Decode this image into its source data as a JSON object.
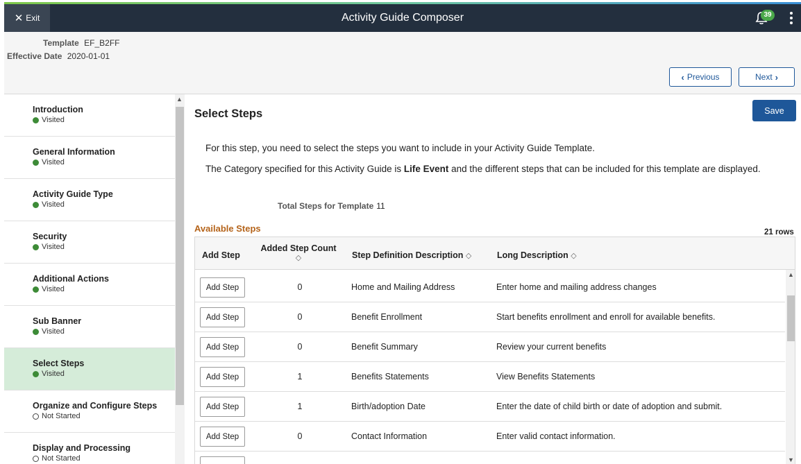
{
  "header": {
    "exit_label": "Exit",
    "title": "Activity Guide Composer",
    "notification_count": "39"
  },
  "info": {
    "template_label": "Template",
    "template_value": "EF_B2FF",
    "effective_date_label": "Effective Date",
    "effective_date_value": "2020-01-01"
  },
  "nav_buttons": {
    "previous": "Previous",
    "next": "Next"
  },
  "sidebar": {
    "items": [
      {
        "label": "Introduction",
        "status": "Visited"
      },
      {
        "label": "General Information",
        "status": "Visited"
      },
      {
        "label": "Activity Guide Type",
        "status": "Visited"
      },
      {
        "label": "Security",
        "status": "Visited"
      },
      {
        "label": "Additional Actions",
        "status": "Visited"
      },
      {
        "label": "Sub Banner",
        "status": "Visited"
      },
      {
        "label": "Select Steps",
        "status": "Visited"
      },
      {
        "label": "Organize and Configure Steps",
        "status": "Not Started"
      },
      {
        "label": "Display and Processing",
        "status": "Not Started"
      }
    ]
  },
  "main": {
    "title": "Select Steps",
    "save_label": "Save",
    "intro_text": "For this step, you need to select the steps you want to include in your Activity Guide Template.",
    "category_text_before": "The Category specified for this Activity Guide is ",
    "category_value": "Life Event",
    "category_text_after": " and the different steps that can be included for this template are displayed.",
    "total_label": "Total Steps for Template",
    "total_value": "11",
    "section_title": "Available Steps",
    "row_count": "21 rows"
  },
  "table": {
    "columns": [
      "Add Step",
      "Added Step Count",
      "Step Definition Description",
      "Long Description"
    ],
    "add_button_label": "Add Step",
    "rows": [
      {
        "count": "0",
        "definition": "Home and Mailing Address",
        "long": "Enter home and mailing address changes"
      },
      {
        "count": "0",
        "definition": "Benefit Enrollment",
        "long": "Start benefits enrollment and enroll for available benefits."
      },
      {
        "count": "0",
        "definition": "Benefit Summary",
        "long": "Review your current benefits"
      },
      {
        "count": "1",
        "definition": "Benefits Statements",
        "long": "View Benefits Statements"
      },
      {
        "count": "1",
        "definition": "Birth/adoption Date",
        "long": "Enter the date of child birth or date of adoption and submit."
      },
      {
        "count": "0",
        "definition": "Contact Information",
        "long": "Enter valid contact information."
      }
    ]
  },
  "colors": {
    "banner": "#232f3e",
    "primary": "#1e5799",
    "visited": "#3d8b37",
    "active_nav": "#d5ecd9",
    "section_title": "#b5641b"
  }
}
